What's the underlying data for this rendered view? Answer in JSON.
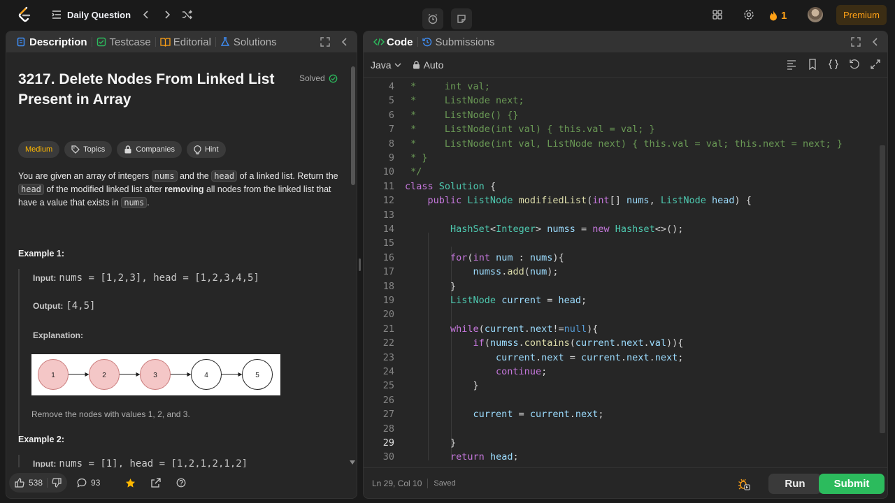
{
  "topbar": {
    "daily_question": "Daily Question",
    "streak_count": "1",
    "premium": "Premium"
  },
  "left": {
    "tabs": [
      {
        "label": "Description",
        "active": true
      },
      {
        "label": "Testcase"
      },
      {
        "label": "Editorial"
      },
      {
        "label": "Solutions"
      }
    ],
    "title": "3217. Delete Nodes From Linked List Present in Array",
    "solved": "Solved",
    "chips": {
      "difficulty": "Medium",
      "topics": "Topics",
      "companies": "Companies",
      "hint": "Hint"
    },
    "description": {
      "p1": "You are given an array of integers ",
      "c1": "nums",
      "p2": " and the ",
      "c2": "head",
      "p3": " of a linked list. Return the ",
      "c3": "head",
      "p4": " of the modified linked list after ",
      "b1": "removing",
      "p5": " all nodes from the linked list that have a value that exists in ",
      "c4": "nums",
      "p6": "."
    },
    "example1": {
      "heading": "Example 1:",
      "input_label": "Input:",
      "input_value": "nums = [1,2,3], head = [1,2,3,4,5]",
      "output_label": "Output:",
      "output_value": "[4,5]",
      "explanation_label": "Explanation:",
      "nodes": [
        "1",
        "2",
        "3",
        "4",
        "5"
      ],
      "explanation_text": "Remove the nodes with values 1, 2, and 3."
    },
    "example2": {
      "heading": "Example 2:",
      "input_label": "Input:",
      "input_value": "nums = [1], head = [1,2,1,2,1,2]"
    },
    "footer": {
      "likes": "538",
      "comments": "93"
    }
  },
  "right": {
    "tabs": [
      {
        "label": "Code",
        "active": true
      },
      {
        "label": "Submissions"
      }
    ],
    "language": "Java",
    "mode": "Auto",
    "code_lines": [
      {
        "n": "4",
        "parts": [
          [
            "c",
            " *     int val;"
          ]
        ]
      },
      {
        "n": "5",
        "parts": [
          [
            "c",
            " *     ListNode next;"
          ]
        ]
      },
      {
        "n": "6",
        "parts": [
          [
            "c",
            " *     ListNode() {}"
          ]
        ]
      },
      {
        "n": "7",
        "parts": [
          [
            "c",
            " *     ListNode(int val) { this.val = val; }"
          ]
        ]
      },
      {
        "n": "8",
        "parts": [
          [
            "c",
            " *     ListNode(int val, ListNode next) { this.val = val; this.next = next; }"
          ]
        ]
      },
      {
        "n": "9",
        "parts": [
          [
            "c",
            " * }"
          ]
        ]
      },
      {
        "n": "10",
        "parts": [
          [
            "c",
            " */"
          ]
        ]
      },
      {
        "n": "11",
        "parts": [
          [
            "k",
            "class "
          ],
          [
            "t",
            "Solution"
          ],
          [
            "p",
            " {"
          ]
        ]
      },
      {
        "n": "12",
        "parts": [
          [
            "p",
            "    "
          ],
          [
            "k",
            "public "
          ],
          [
            "t",
            "ListNode "
          ],
          [
            "f",
            "modifiedList"
          ],
          [
            "p",
            "("
          ],
          [
            "k",
            "int"
          ],
          [
            "p",
            "[] "
          ],
          [
            "v",
            "nums"
          ],
          [
            "p",
            ", "
          ],
          [
            "t",
            "ListNode "
          ],
          [
            "v",
            "head"
          ],
          [
            "p",
            ") {"
          ]
        ]
      },
      {
        "n": "13",
        "parts": [
          [
            "p",
            ""
          ]
        ]
      },
      {
        "n": "14",
        "parts": [
          [
            "p",
            "        "
          ],
          [
            "t",
            "HashSet"
          ],
          [
            "p",
            "<"
          ],
          [
            "t",
            "Integer"
          ],
          [
            "p",
            "> "
          ],
          [
            "v",
            "numss"
          ],
          [
            "p",
            " = "
          ],
          [
            "k",
            "new "
          ],
          [
            "t",
            "Hashset"
          ],
          [
            "p",
            "<>();"
          ]
        ]
      },
      {
        "n": "15",
        "parts": [
          [
            "p",
            ""
          ]
        ]
      },
      {
        "n": "16",
        "parts": [
          [
            "p",
            "        "
          ],
          [
            "k",
            "for"
          ],
          [
            "p",
            "("
          ],
          [
            "k",
            "int "
          ],
          [
            "v",
            "num"
          ],
          [
            "p",
            " : "
          ],
          [
            "v",
            "nums"
          ],
          [
            "p",
            "){"
          ]
        ]
      },
      {
        "n": "17",
        "parts": [
          [
            "p",
            "            "
          ],
          [
            "v",
            "numss"
          ],
          [
            "p",
            "."
          ],
          [
            "f",
            "add"
          ],
          [
            "p",
            "("
          ],
          [
            "v",
            "num"
          ],
          [
            "p",
            ");"
          ]
        ]
      },
      {
        "n": "18",
        "parts": [
          [
            "p",
            "        }"
          ]
        ]
      },
      {
        "n": "19",
        "parts": [
          [
            "p",
            "        "
          ],
          [
            "t",
            "ListNode "
          ],
          [
            "v",
            "current"
          ],
          [
            "p",
            " = "
          ],
          [
            "v",
            "head"
          ],
          [
            "p",
            ";"
          ]
        ]
      },
      {
        "n": "20",
        "parts": [
          [
            "p",
            ""
          ]
        ]
      },
      {
        "n": "21",
        "parts": [
          [
            "p",
            "        "
          ],
          [
            "k",
            "while"
          ],
          [
            "p",
            "("
          ],
          [
            "v",
            "current"
          ],
          [
            "p",
            "."
          ],
          [
            "v",
            "next"
          ],
          [
            "p",
            "!="
          ],
          [
            "n",
            "null"
          ],
          [
            "p",
            "){"
          ]
        ]
      },
      {
        "n": "22",
        "parts": [
          [
            "p",
            "            "
          ],
          [
            "k",
            "if"
          ],
          [
            "p",
            "("
          ],
          [
            "v",
            "numss"
          ],
          [
            "p",
            "."
          ],
          [
            "f",
            "contains"
          ],
          [
            "p",
            "("
          ],
          [
            "v",
            "current"
          ],
          [
            "p",
            "."
          ],
          [
            "v",
            "next"
          ],
          [
            "p",
            "."
          ],
          [
            "v",
            "val"
          ],
          [
            "p",
            ")){"
          ]
        ]
      },
      {
        "n": "23",
        "parts": [
          [
            "p",
            "                "
          ],
          [
            "v",
            "current"
          ],
          [
            "p",
            "."
          ],
          [
            "v",
            "next"
          ],
          [
            "p",
            " = "
          ],
          [
            "v",
            "current"
          ],
          [
            "p",
            "."
          ],
          [
            "v",
            "next"
          ],
          [
            "p",
            "."
          ],
          [
            "v",
            "next"
          ],
          [
            "p",
            ";"
          ]
        ]
      },
      {
        "n": "24",
        "parts": [
          [
            "p",
            "                "
          ],
          [
            "k",
            "continue"
          ],
          [
            "p",
            ";"
          ]
        ]
      },
      {
        "n": "25",
        "parts": [
          [
            "p",
            "            }"
          ]
        ]
      },
      {
        "n": "26",
        "parts": [
          [
            "p",
            ""
          ]
        ]
      },
      {
        "n": "27",
        "parts": [
          [
            "p",
            "            "
          ],
          [
            "v",
            "current"
          ],
          [
            "p",
            " = "
          ],
          [
            "v",
            "current"
          ],
          [
            "p",
            "."
          ],
          [
            "v",
            "next"
          ],
          [
            "p",
            ";"
          ]
        ]
      },
      {
        "n": "28",
        "parts": [
          [
            "p",
            ""
          ]
        ]
      },
      {
        "n": "29",
        "parts": [
          [
            "p",
            "        }"
          ]
        ]
      },
      {
        "n": "30",
        "parts": [
          [
            "p",
            "        "
          ],
          [
            "k",
            "return "
          ],
          [
            "v",
            "head"
          ],
          [
            "p",
            ";"
          ]
        ]
      }
    ],
    "status": {
      "cursor": "Ln 29, Col 10",
      "saved": "Saved"
    },
    "run": "Run",
    "submit": "Submit"
  },
  "colors": {
    "accent_orange": "#ffa116",
    "submit_green": "#2cbb5d",
    "medium": "#ffb800"
  }
}
